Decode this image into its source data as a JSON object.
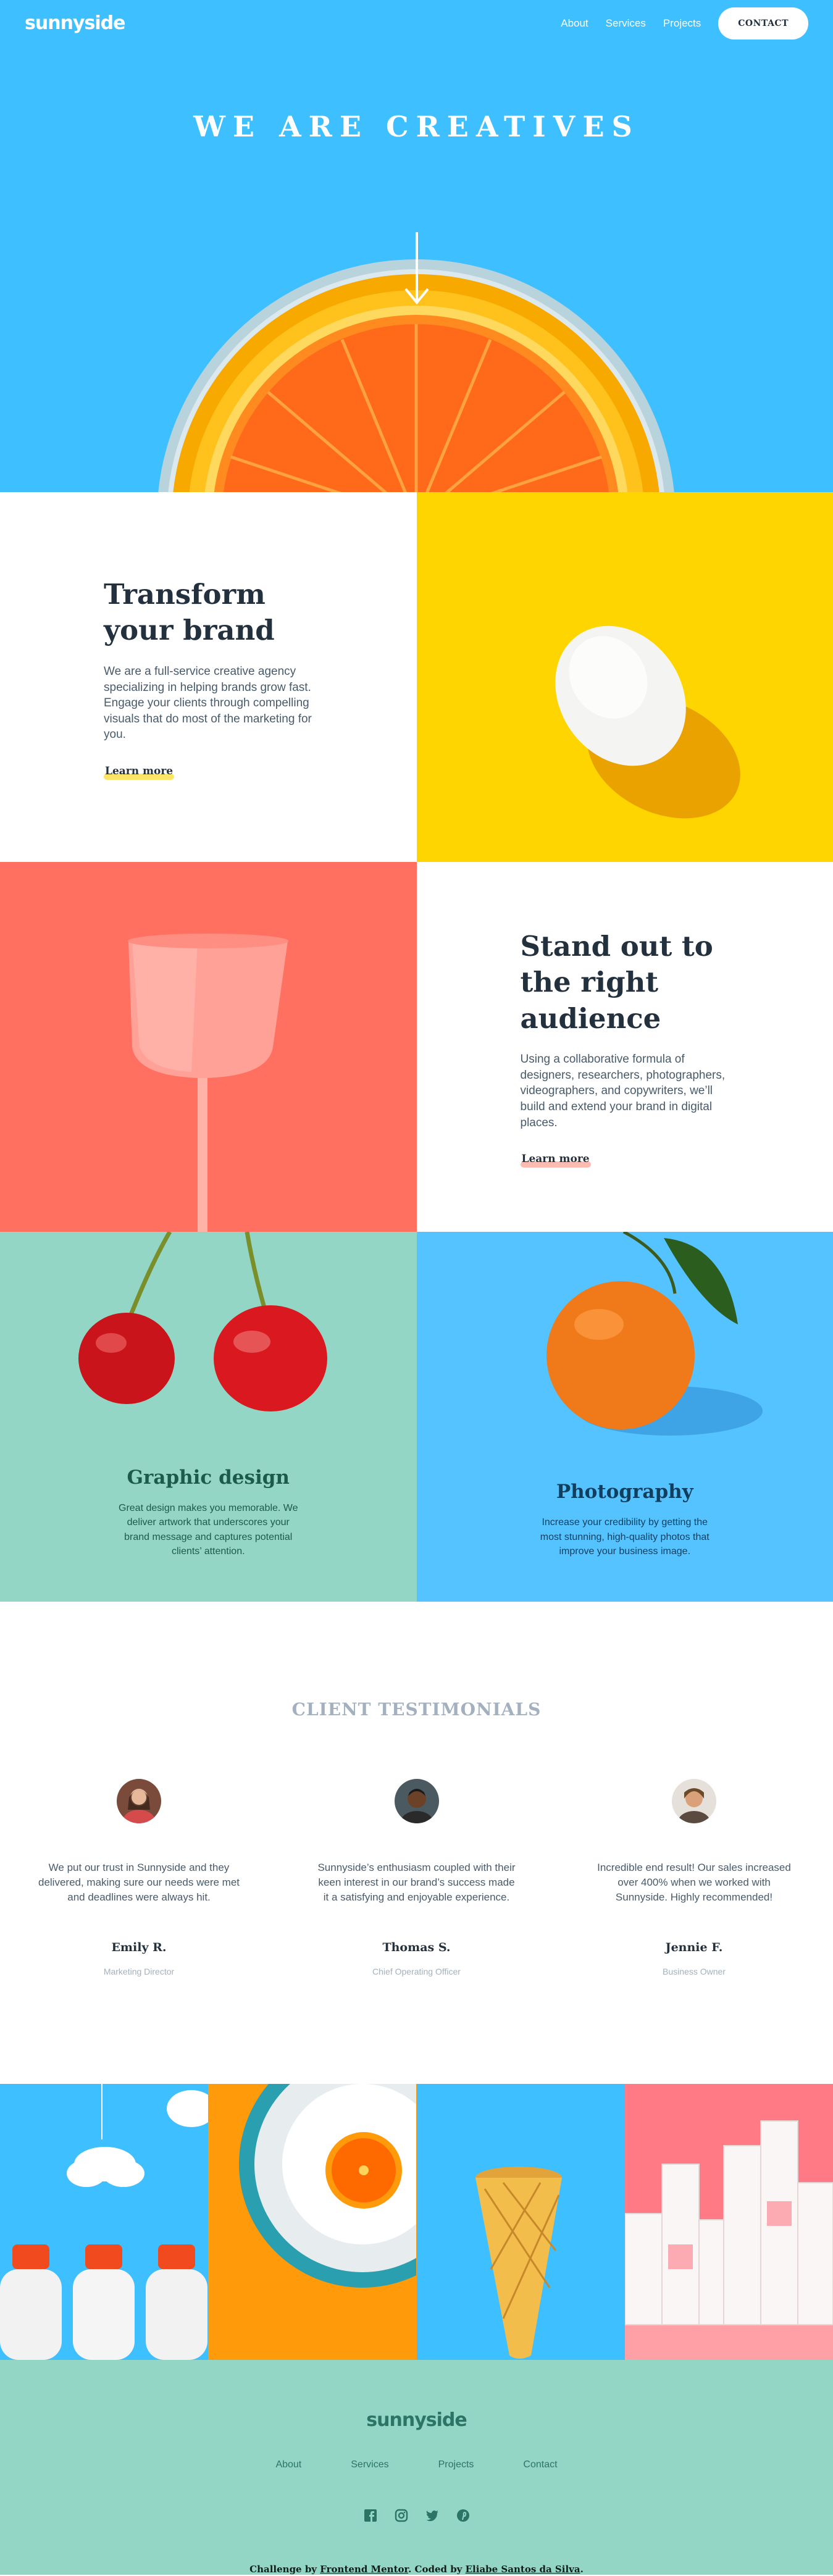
{
  "header": {
    "logo": "sunnyside",
    "nav": [
      {
        "label": "About"
      },
      {
        "label": "Services"
      },
      {
        "label": "Projects"
      }
    ],
    "contact_label": "CONTACT"
  },
  "hero": {
    "title": "WE ARE CREATIVES",
    "arrow_icon": "arrow-down-icon"
  },
  "features": [
    {
      "title": "Transform your brand",
      "text": "We are a full-service creative agency specializing in helping brands grow fast. Engage your clients through compelling visuals that do most of the marketing for you.",
      "link": "Learn more",
      "underline_color": "#fad400"
    },
    {
      "title": "Stand out to the right audience",
      "text": "Using a collaborative formula of designers, researchers, photographers, videographers, and copywriters, we’ll build and extend your brand in digital places.",
      "link": "Learn more",
      "underline_color": "#fe7865"
    }
  ],
  "services": [
    {
      "title": "Graphic design",
      "text": "Great design makes you memorable. We deliver artwork that underscores your brand message and captures potential clients’ attention."
    },
    {
      "title": "Photography",
      "text": "Increase your credibility by getting the most stunning, high-quality photos that improve your business image."
    }
  ],
  "testimonials": {
    "heading": "CLIENT TESTIMONIALS",
    "items": [
      {
        "quote": "We put our trust in Sunnyside and they delivered, making sure our needs were met and deadlines were always hit.",
        "name": "Emily R.",
        "role": "Marketing Director"
      },
      {
        "quote": "Sunnyside’s enthusiasm coupled with their keen interest in our brand’s success made it a satisfying and enjoyable experience.",
        "name": "Thomas S.",
        "role": "Chief Operating Officer"
      },
      {
        "quote": "Incredible end result! Our sales increased over 400% when we worked with Sunnyside. Highly recommended!",
        "name": "Jennie F.",
        "role": "Business Owner"
      }
    ]
  },
  "footer": {
    "logo": "sunnyside",
    "nav": [
      {
        "label": "About"
      },
      {
        "label": "Services"
      },
      {
        "label": "Projects"
      },
      {
        "label": "Contact"
      }
    ],
    "social": [
      "facebook-icon",
      "instagram-icon",
      "twitter-icon",
      "pinterest-icon"
    ],
    "attribution": {
      "prefix": "Challenge by ",
      "link1": "Frontend Mentor",
      "middle": ". Coded by ",
      "link2": "Eliabe Santos da Silva",
      "suffix": "."
    }
  },
  "colors": {
    "hero_bg": "#3ebfff",
    "egg_bg": "#ffd500",
    "glass_bg": "#ff7061",
    "cherry_bg": "#93d6c6",
    "mandarin_bg": "#55c3ff",
    "footer_bg": "#93d6c6",
    "text_dark": "#23303e"
  }
}
